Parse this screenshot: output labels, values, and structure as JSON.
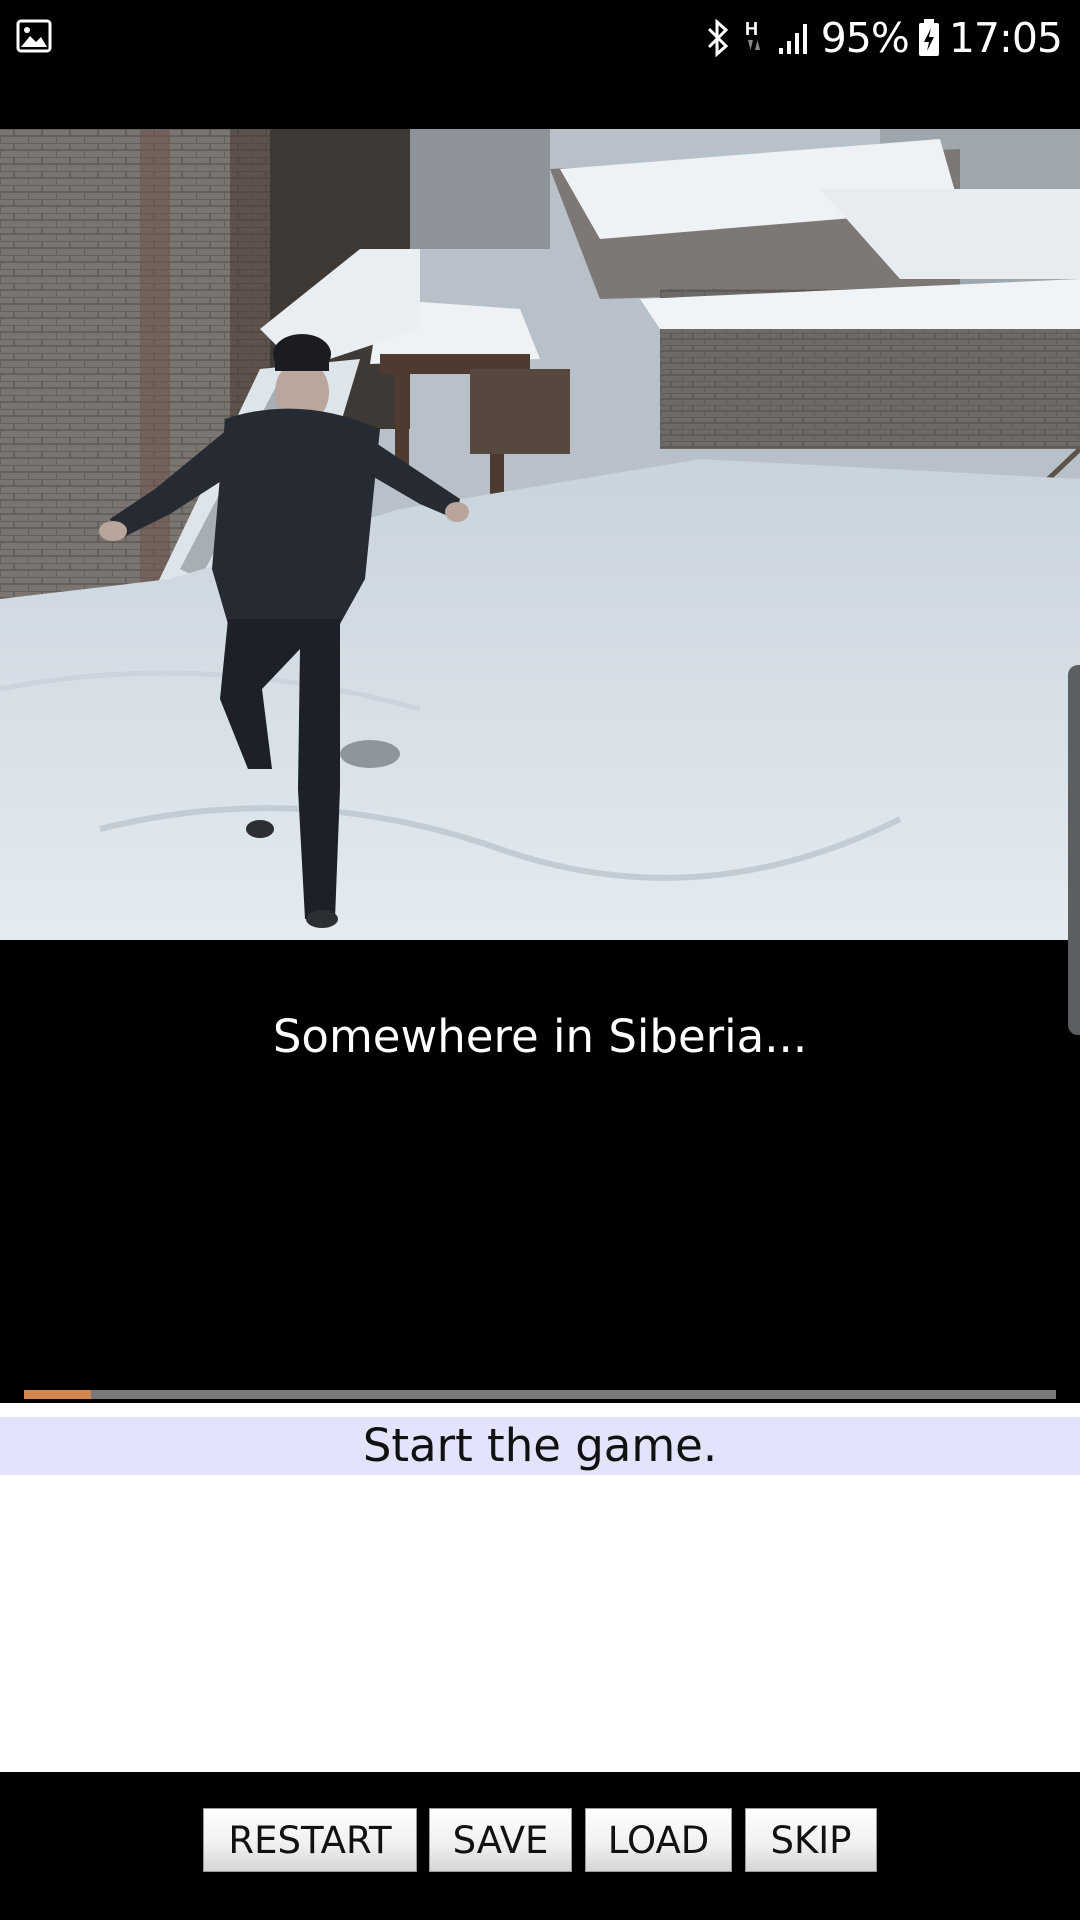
{
  "status_bar": {
    "battery": "95%",
    "time": "17:05",
    "network_label": "H",
    "icons": [
      "gallery-icon",
      "bluetooth-icon",
      "network-h-icon",
      "signal-icon",
      "battery-charging-icon"
    ]
  },
  "scene": {
    "image": "snowy-siberian-yard-man-walking",
    "caption": "Somewhere in Siberia..."
  },
  "progress": {
    "value_percent": 6.5,
    "fill_color": "#d4874c",
    "track_color": "#7a7a7a"
  },
  "choices": [
    {
      "label": "Start the game."
    }
  ],
  "toolbar": {
    "restart_label": "RESTART",
    "save_label": "SAVE",
    "load_label": "LOAD",
    "skip_label": "SKIP"
  },
  "colors": {
    "background": "#000000",
    "choice_highlight": "#e3e3fb"
  }
}
